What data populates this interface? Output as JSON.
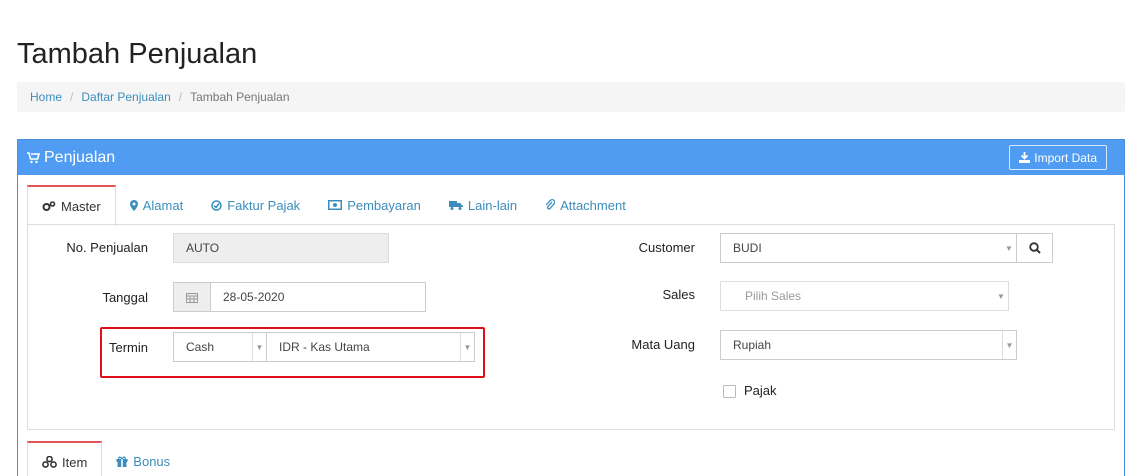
{
  "page": {
    "title": "Tambah Penjualan"
  },
  "breadcrumb": {
    "home": "Home",
    "list": "Daftar Penjualan",
    "current": "Tambah Penjualan",
    "separator": "/"
  },
  "panel": {
    "title": "Penjualan",
    "import_label": "Import Data",
    "icon": "cart-icon"
  },
  "tabs": [
    {
      "label": "Master",
      "icon": "gears-icon"
    },
    {
      "label": "Alamat",
      "icon": "map-marker-icon"
    },
    {
      "label": "Faktur Pajak",
      "icon": "check-circle-icon"
    },
    {
      "label": "Pembayaran",
      "icon": "money-icon"
    },
    {
      "label": "Lain-lain",
      "icon": "truck-icon"
    },
    {
      "label": "Attachment",
      "icon": "paperclip-icon"
    }
  ],
  "form": {
    "no_penjualan": {
      "label": "No. Penjualan",
      "value": "AUTO"
    },
    "tanggal": {
      "label": "Tanggal",
      "value": "28-05-2020"
    },
    "termin": {
      "label": "Termin",
      "value": "Cash",
      "account": "IDR - Kas Utama"
    },
    "customer": {
      "label": "Customer",
      "value": "BUDI"
    },
    "sales": {
      "label": "Sales",
      "placeholder": "Pilih Sales"
    },
    "mata_uang": {
      "label": "Mata Uang",
      "value": "Rupiah"
    },
    "pajak": {
      "label": "Pajak",
      "checked": false
    }
  },
  "bottom_tabs": [
    {
      "label": "Item",
      "icon": "cubes-icon"
    },
    {
      "label": "Bonus",
      "icon": "gift-icon"
    }
  ],
  "colors": {
    "panel_header": "#4f9cf2",
    "link": "#3c8dbc",
    "highlight": "#e0101a",
    "active_tab_border": "#e05656"
  }
}
